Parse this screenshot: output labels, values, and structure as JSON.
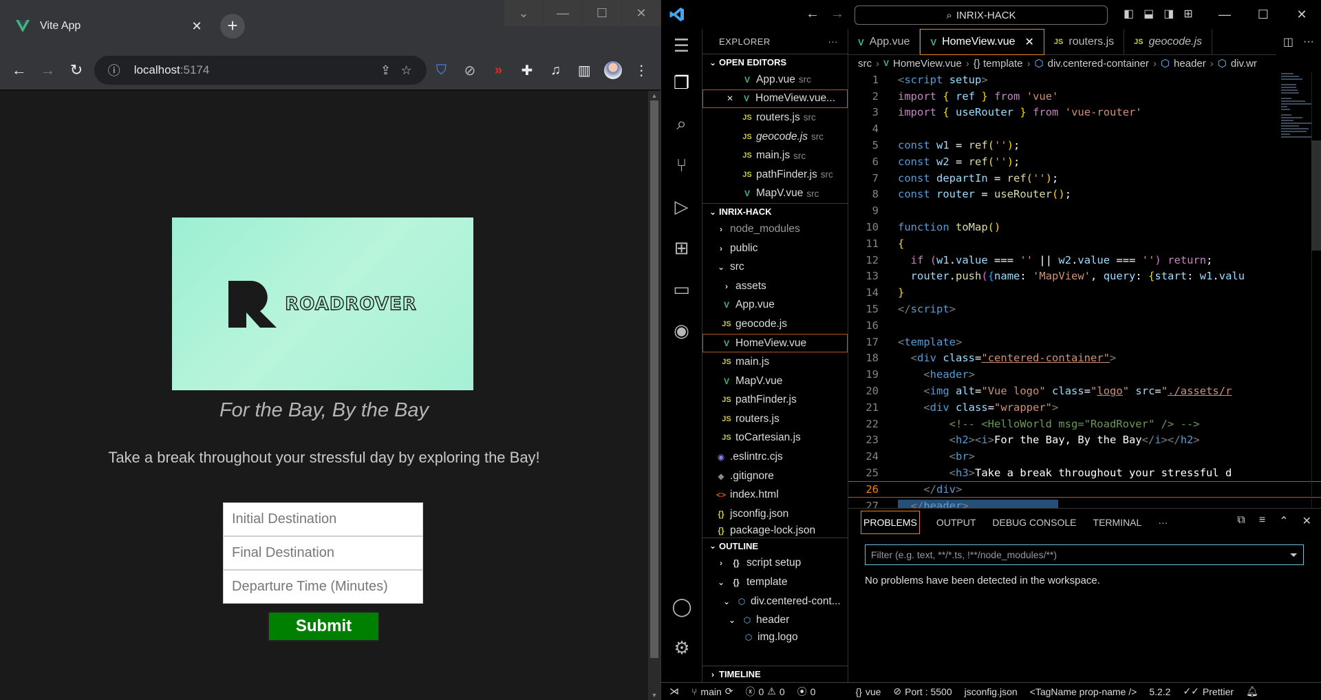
{
  "browser": {
    "tab_title": "Vite App",
    "url_host": "localhost",
    "url_port": ":5174"
  },
  "app": {
    "logo_text": "ROADROVER",
    "tagline": "For the Bay, By the Bay",
    "blurb": "Take a break throughout your stressful day by exploring the Bay!",
    "inputs": [
      {
        "placeholder": "Initial Destination"
      },
      {
        "placeholder": "Final Destination"
      },
      {
        "placeholder": "Departure Time (Minutes)"
      }
    ],
    "submit_label": "Submit",
    "colors": {
      "logo_bg": "#a6f0d5",
      "submit_bg": "#008000",
      "page_bg": "#1a1a1a"
    }
  },
  "vscode": {
    "command_center": "INRIX-HACK",
    "explorer_title": "EXPLORER",
    "open_editors_title": "OPEN EDITORS",
    "open_editors": [
      {
        "name": "App.vue",
        "desc": "src",
        "type": "vue"
      },
      {
        "name": "HomeView.vue...",
        "desc": "",
        "type": "vue"
      },
      {
        "name": "routers.js",
        "desc": "src",
        "type": "js"
      },
      {
        "name": "geocode.js",
        "desc": "src",
        "type": "js"
      },
      {
        "name": "main.js",
        "desc": "src",
        "type": "js"
      },
      {
        "name": "pathFinder.js",
        "desc": "src",
        "type": "js"
      },
      {
        "name": "MapV.vue",
        "desc": "src",
        "type": "vue"
      }
    ],
    "project_title": "INRIX-HACK",
    "tree": [
      {
        "name": "node_modules",
        "kind": "folder"
      },
      {
        "name": "public",
        "kind": "folder"
      },
      {
        "name": "src",
        "kind": "folder-open"
      },
      {
        "name": "assets",
        "kind": "folder"
      },
      {
        "name": "App.vue",
        "kind": "vue"
      },
      {
        "name": "geocode.js",
        "kind": "js"
      },
      {
        "name": "HomeView.vue",
        "kind": "vue"
      },
      {
        "name": "main.js",
        "kind": "js"
      },
      {
        "name": "MapV.vue",
        "kind": "vue"
      },
      {
        "name": "pathFinder.js",
        "kind": "js"
      },
      {
        "name": "routers.js",
        "kind": "js"
      },
      {
        "name": "toCartesian.js",
        "kind": "js"
      },
      {
        "name": ".eslintrc.cjs",
        "kind": "eslint"
      },
      {
        "name": ".gitignore",
        "kind": "git"
      },
      {
        "name": "index.html",
        "kind": "html"
      },
      {
        "name": "jsconfig.json",
        "kind": "json"
      },
      {
        "name": "package-lock.json",
        "kind": "json"
      }
    ],
    "outline_title": "OUTLINE",
    "outline": [
      {
        "name": "script setup"
      },
      {
        "name": "template"
      },
      {
        "name": "div.centered-cont..."
      },
      {
        "name": "header"
      },
      {
        "name": "img.logo"
      }
    ],
    "timeline_title": "TIMELINE",
    "tabs": [
      {
        "name": "App.vue"
      },
      {
        "name": "HomeView.vue"
      },
      {
        "name": "routers.js"
      },
      {
        "name": "geocode.js"
      }
    ],
    "breadcrumb": [
      "src",
      "HomeView.vue",
      "{} template",
      "div.centered-container",
      "header",
      "div.wr"
    ],
    "line_numbers": [
      "1",
      "2",
      "3",
      "4",
      "5",
      "6",
      "7",
      "8",
      "9",
      "10",
      "11",
      "12",
      "13",
      "14",
      "15",
      "16",
      "17",
      "18",
      "19",
      "20",
      "21",
      "22",
      "23",
      "24",
      "25",
      "26",
      "27"
    ],
    "panel_tabs": [
      "PROBLEMS",
      "OUTPUT",
      "DEBUG CONSOLE",
      "TERMINAL"
    ],
    "filter_placeholder": "Filter (e.g. text, **/*.ts, !**/node_modules/**)",
    "no_problems": "No problems have been detected in the workspace.",
    "status": {
      "branch": "main",
      "errors": "0",
      "warnings": "0",
      "ports": "0",
      "lang": "vue",
      "port": "Port : 5500",
      "config": "jsconfig.json",
      "tagname": "<TagName prop-name />",
      "version": "5.2.2",
      "prettier": "Prettier"
    }
  }
}
